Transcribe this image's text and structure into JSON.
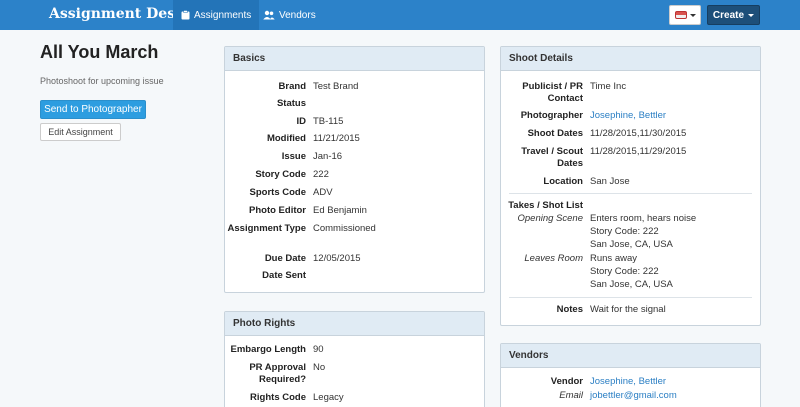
{
  "navbar": {
    "brand": "Assignment Desk",
    "tabs": [
      {
        "label": "Assignments",
        "icon": "clipboard-icon",
        "active": true
      },
      {
        "label": "Vendors",
        "icon": "users-icon",
        "active": false
      }
    ],
    "create_label": "Create",
    "colors": {
      "bar": "#2c82c9",
      "create": "#1d4f79"
    }
  },
  "page": {
    "title": "All You March",
    "subtitle": "Photoshoot for upcoming issue",
    "send_button": "Send to Photographer",
    "edit_button": "Edit Assignment"
  },
  "basics": {
    "heading": "Basics",
    "rows": [
      {
        "label": "Brand",
        "value": "Test Brand"
      },
      {
        "label": "Status",
        "value": ""
      },
      {
        "label": "ID",
        "value": "TB-115"
      },
      {
        "label": "Modified",
        "value": "11/21/2015"
      },
      {
        "label": "Issue",
        "value": "Jan-16"
      },
      {
        "label": "Story Code",
        "value": "222"
      },
      {
        "label": "Sports Code",
        "value": "ADV"
      },
      {
        "label": "Photo Editor",
        "value": "Ed Benjamin"
      },
      {
        "label": "Assignment Type",
        "value": "Commissioned"
      },
      {
        "label": "Due Date",
        "value": "12/05/2015"
      },
      {
        "label": "Date Sent",
        "value": ""
      }
    ]
  },
  "photo_rights": {
    "heading": "Photo Rights",
    "rows": [
      {
        "label": "Embargo Length",
        "value": "90"
      },
      {
        "label": "PR Approval Required?",
        "value": "No"
      },
      {
        "label": "Rights Code",
        "value": "Legacy"
      }
    ]
  },
  "shoot_details": {
    "heading": "Shoot Details",
    "rows": [
      {
        "label": "Publicist / PR Contact",
        "value": "Time Inc"
      },
      {
        "label": "Photographer",
        "value": "Josephine, Bettler"
      },
      {
        "label": "Shoot Dates",
        "value": "11/28/2015,11/30/2015"
      },
      {
        "label": "Travel / Scout Dates",
        "value": "11/28/2015,11/29/2015"
      },
      {
        "label": "Location",
        "value": "San Jose"
      }
    ],
    "takes_label": "Takes / Shot List",
    "takes": [
      {
        "name": "Opening Scene",
        "description": "Enters room, hears noise",
        "story_code": "Story Code: 222",
        "place": "San Jose, CA, USA"
      },
      {
        "name": "Leaves Room",
        "description": "Runs away",
        "story_code": "Story Code: 222",
        "place": "San Jose, CA, USA"
      }
    ],
    "notes_label": "Notes",
    "notes": "Wait for the signal"
  },
  "vendors": {
    "heading": "Vendors",
    "vendor_label": "Vendor",
    "vendor": "Josephine, Bettler",
    "email_label": "Email",
    "email": "jobettler@gmail.com"
  }
}
